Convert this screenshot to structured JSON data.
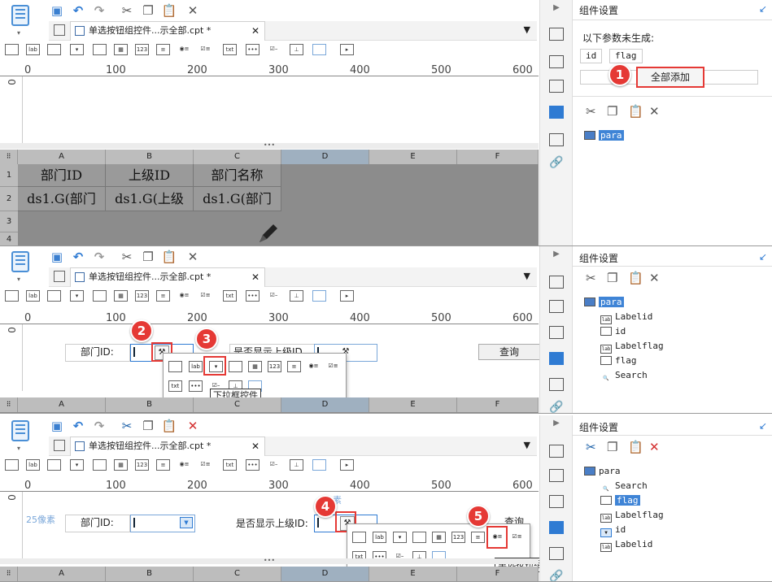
{
  "file_tab": "单选按钮组控件...示全部.cpt *",
  "settings_title": "组件设置",
  "panel1": {
    "params_not_generated": "以下参数未生成:",
    "params": [
      "id",
      "flag"
    ],
    "add_all_button": "全部添加",
    "tree": [
      "para"
    ],
    "badge": "1",
    "ruler": [
      "0",
      "100",
      "200",
      "300",
      "400",
      "500",
      "600"
    ],
    "columns": [
      "A",
      "B",
      "C",
      "D",
      "E",
      "F"
    ],
    "rows": [
      "1",
      "2",
      "3",
      "4"
    ],
    "cells_row1": [
      "部门ID",
      "上级ID",
      "部门名称"
    ],
    "cells_row2": [
      "ds1.G(部门",
      "ds1.G(上级",
      "ds1.G(部门"
    ]
  },
  "panel2": {
    "tree": [
      "para",
      "Labelid",
      "id",
      "Labelflag",
      "flag",
      "Search"
    ],
    "dept_label": "部门ID:",
    "show_parent_label": "是否显示上级ID",
    "query_button": "查询",
    "badges": [
      "2",
      "3"
    ],
    "tooltip": "下拉框控件",
    "ruler": [
      "0",
      "100",
      "200",
      "300",
      "400",
      "500",
      "600"
    ],
    "columns": [
      "A",
      "B",
      "C",
      "D",
      "E",
      "F"
    ]
  },
  "panel3": {
    "tree": [
      "para",
      "Search",
      "flag",
      "Labelflag",
      "id",
      "Labelid"
    ],
    "dept_label": "部门ID:",
    "show_parent_label": "是否显示上级ID:",
    "query_button": "查询",
    "pixel_label": "25像素",
    "pixel_label_top": "像素",
    "badges": [
      "4",
      "5"
    ],
    "tooltip": "单选按钮组控件",
    "ruler": [
      "0",
      "100",
      "200",
      "300",
      "400",
      "500",
      "600"
    ],
    "columns": [
      "A",
      "B",
      "C",
      "D",
      "E",
      "F"
    ]
  },
  "icons": {
    "save": "save-icon",
    "undo": "undo-icon",
    "redo": "redo-icon",
    "cut": "scissors-icon",
    "copy": "copy-icon",
    "paste": "paste-icon",
    "delete": "delete-icon"
  },
  "colors": {
    "accent": "#2f7bd3",
    "badge": "#e53935"
  }
}
